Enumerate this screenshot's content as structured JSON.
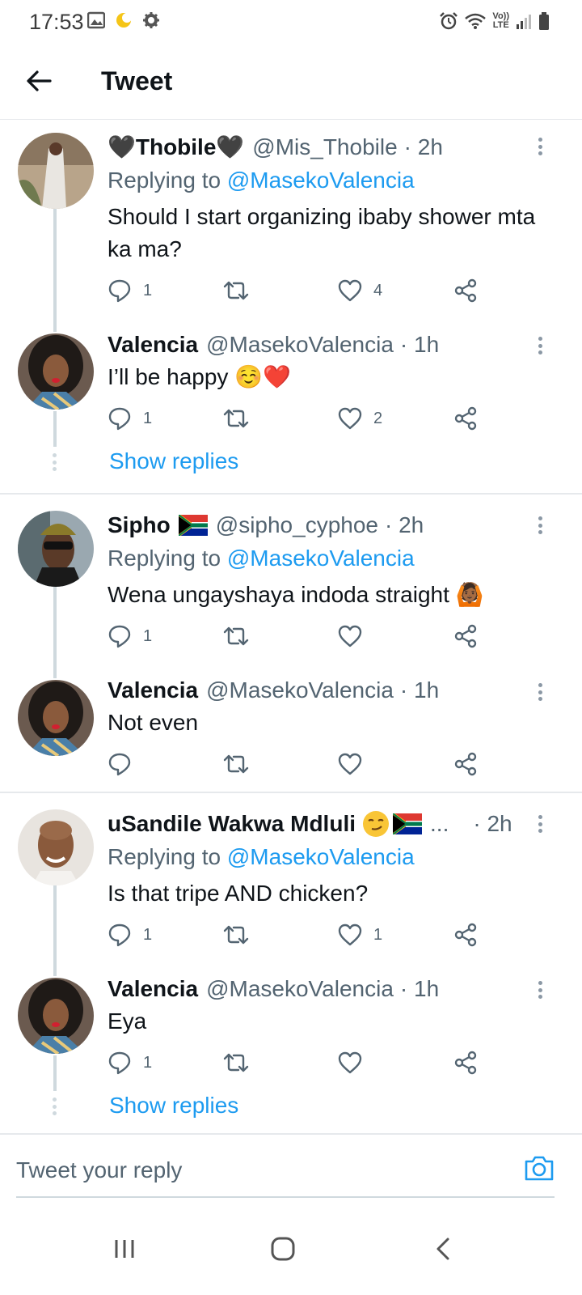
{
  "status_bar": {
    "time": "17:53",
    "left_icons": [
      "image-icon",
      "moon-icon",
      "gear-icon"
    ],
    "right_icons": [
      "alarm-icon",
      "wifi-icon",
      "volte-icon",
      "signal-icon",
      "battery-icon"
    ],
    "volte_line1": "Vo))",
    "volte_line2": "LTE"
  },
  "header": {
    "title": "Tweet",
    "back_icon": "arrow-left-icon"
  },
  "colors": {
    "accent": "#1d9bf0",
    "text": "#0f1419",
    "muted": "#536471",
    "divider": "#e6e9ec",
    "heart": "#c4162a"
  },
  "tweets": [
    {
      "name": "🖤Thobile🖤",
      "handle": "@Mis_Thobile",
      "time": "· 2h",
      "replying_prefix": "Replying to ",
      "replying_to": "@MasekoValencia",
      "text": "Should I start organizing ibaby shower mta ka ma?",
      "reply_count": "1",
      "retweet_count": "",
      "like_count": "4"
    },
    {
      "name": "Valencia",
      "handle": "@MasekoValencia",
      "time": "· 1h",
      "text": "I’ll be happy ☺️❤️",
      "reply_count": "1",
      "retweet_count": "",
      "like_count": "2",
      "show_replies": "Show replies"
    },
    {
      "name": "Sipho",
      "handle": "@sipho_cyphoe",
      "time": "· 2h",
      "replying_prefix": "Replying to ",
      "replying_to": "@MasekoValencia",
      "text": "Wena ungayshaya indoda straight 🙆🏾",
      "reply_count": "1",
      "retweet_count": "",
      "like_count": ""
    },
    {
      "name": "Valencia",
      "handle": "@MasekoValencia",
      "time": "· 1h",
      "text": "Not even",
      "reply_count": "",
      "retweet_count": "",
      "like_count": ""
    },
    {
      "name": "uSandile Wakwa Mdluli",
      "name_suffix": "...",
      "handle": "",
      "time": "· 2h",
      "replying_prefix": "Replying to ",
      "replying_to": "@MasekoValencia",
      "text": "Is that tripe AND chicken?",
      "reply_count": "1",
      "retweet_count": "",
      "like_count": "1"
    },
    {
      "name": "Valencia",
      "handle": "@MasekoValencia",
      "time": "· 1h",
      "text": "Eya",
      "reply_count": "1",
      "retweet_count": "",
      "like_count": "",
      "show_replies": "Show replies"
    }
  ],
  "reply_bar": {
    "placeholder": "Tweet your reply",
    "camera_icon": "camera-icon"
  },
  "nav_bar": {
    "icons": [
      "recent-apps-icon",
      "home-icon",
      "back-icon"
    ]
  }
}
